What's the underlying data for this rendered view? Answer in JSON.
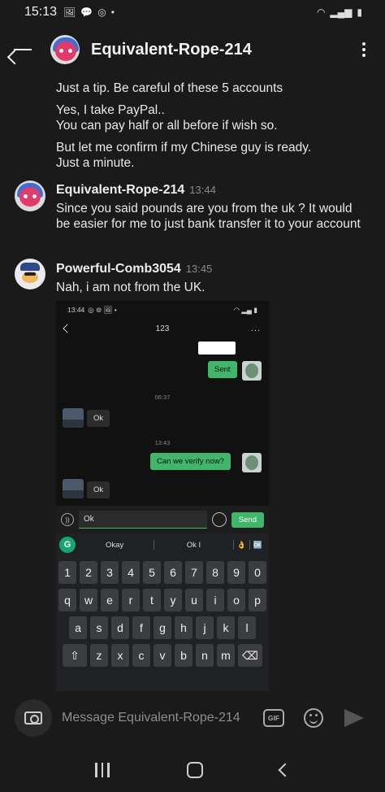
{
  "status_bar": {
    "time": "15:13",
    "left_icons": [
      "🖼",
      "💬",
      "◎",
      "•"
    ],
    "right_icons": [
      "wifi",
      "signal",
      "battery"
    ]
  },
  "header": {
    "title": "Equivalent-Rope-214"
  },
  "messages": {
    "m1": "Just a tip. Be careful of these 5 accounts",
    "m2": "Yes, I take PayPal..\nYou can pay half or all before if wish so.",
    "m3": "But let me confirm if my Chinese guy is ready.\nJust a minute.",
    "g2": {
      "sender": "Equivalent-Rope-214",
      "time": "13:44",
      "text": "Since you said pounds are you from the uk ? It would be easier for me to just bank transfer it to your account"
    },
    "g3": {
      "sender": "Powerful-Comb3054",
      "time": "13:45",
      "text": "Nah, i am not from the UK."
    }
  },
  "embedded": {
    "status_time": "13:44",
    "status_icons": "◎ ⊚ 🖼 •",
    "title": "123",
    "more": "...",
    "sent_label": "Sent",
    "time1": "06:37",
    "ok1": "Ok",
    "time2": "13:43",
    "verify": "Can we verify now?",
    "ok2": "Ok",
    "input_value": "Ok",
    "send_label": "Send",
    "suggestions": [
      "Okay",
      "Ok I",
      "👌",
      "🆗"
    ],
    "grammarly": "G",
    "keys_num": [
      "1",
      "2",
      "3",
      "4",
      "5",
      "6",
      "7",
      "8",
      "9",
      "0"
    ],
    "keys_row1": [
      "q",
      "w",
      "e",
      "r",
      "t",
      "y",
      "u",
      "i",
      "o",
      "p"
    ],
    "keys_row2": [
      "a",
      "s",
      "d",
      "f",
      "g",
      "h",
      "j",
      "k",
      "l"
    ],
    "keys_row3": [
      "⇧",
      "z",
      "x",
      "c",
      "v",
      "b",
      "n",
      "m",
      "⌫"
    ]
  },
  "composer": {
    "placeholder": "Message Equivalent-Rope-214",
    "gif_label": "GIF"
  },
  "colors": {
    "bg": "#1a1a1b",
    "accent_green": "#3fb66a",
    "text": "#e8e8e8"
  }
}
